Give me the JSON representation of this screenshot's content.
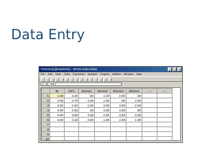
{
  "slide": {
    "title": "Data Entry"
  },
  "window": {
    "title": "*mmmm[1][DataSet1] - SPSS Data Editor",
    "buttons": [
      "_",
      "□",
      "×"
    ]
  },
  "menu": [
    "File",
    "Edit",
    "View",
    "Data",
    "Transform",
    "Analyze",
    "Graphs",
    "Utilities",
    "Window",
    "Help"
  ],
  "toolbar": {
    "icons": [
      "open-icon",
      "save-icon",
      "print-icon",
      "undo-icon",
      "redo-icon",
      "goto-icon",
      "variables-icon",
      "find-icon",
      "insert-cases-icon",
      "insert-variable-icon",
      "split-icon",
      "weight-icon",
      "select-icon",
      "labels-icon",
      "sets-icon"
    ]
  },
  "cell_editor": {
    "ref": "1 : ID",
    "value": "1"
  },
  "grid": {
    "columns": [
      "",
      "ID",
      "GPA",
      "Stress1",
      "Stress2",
      "Stress3",
      "Stress4",
      "var",
      "var"
    ],
    "rows": [
      [
        "1",
        "1.00",
        "3.30",
        ".00",
        "1.00",
        "2.00",
        ".00",
        "",
        ""
      ],
      [
        "2",
        "2.00",
        "3.70",
        "4.00",
        "1.00",
        ".00",
        "2.00",
        "",
        ""
      ],
      [
        "3",
        "3.00",
        "2.30",
        "2.00",
        "3.00",
        "3.00",
        "2.00",
        "",
        ""
      ],
      [
        "4",
        "4.00",
        "2.50",
        ".00",
        "4.00",
        "4.00",
        ".00",
        "",
        ""
      ],
      [
        "5",
        "5.00",
        "3.60",
        "3.00",
        "2.00",
        "3.00",
        "4.00",
        "",
        ""
      ],
      [
        "6",
        "6.00",
        "3.10",
        "3.00",
        "1.00",
        "2.00",
        "1.00",
        "",
        ""
      ],
      [
        "7",
        "",
        "",
        "",
        "",
        "",
        "",
        "",
        ""
      ],
      [
        "8",
        "",
        "",
        "",
        "",
        "",
        "",
        "",
        ""
      ],
      [
        "9",
        "",
        "",
        "",
        "",
        "",
        "",
        "",
        ""
      ],
      [
        "10",
        "",
        "",
        "",
        "",
        "",
        "",
        "",
        ""
      ],
      [
        "11",
        "",
        "",
        "",
        "",
        "",
        "",
        "",
        ""
      ]
    ]
  }
}
